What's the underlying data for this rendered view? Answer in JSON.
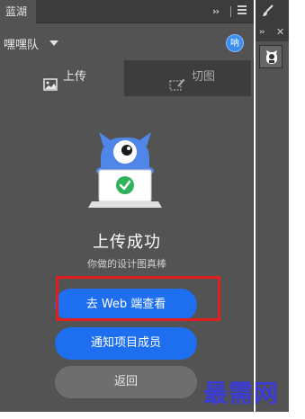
{
  "panel": {
    "tab_label": "蓝湖",
    "team_name": "嘿嘿队",
    "avatar_text": "呐"
  },
  "mode_tabs": [
    {
      "label": "上传",
      "icon": "image-icon",
      "active": true
    },
    {
      "label": "切图",
      "icon": "slice-icon",
      "active": false
    }
  ],
  "result": {
    "title": "上传成功",
    "subtitle": "你做的设计图真棒"
  },
  "buttons": {
    "view_web": "去 Web 端查看",
    "notify_members": "通知项目成员",
    "back": "返回"
  },
  "watermark": "最需网",
  "colors": {
    "panel_bg": "#535353",
    "primary": "#1e6ff0",
    "highlight": "#e31e1e",
    "mascot": "#4f86e8"
  }
}
